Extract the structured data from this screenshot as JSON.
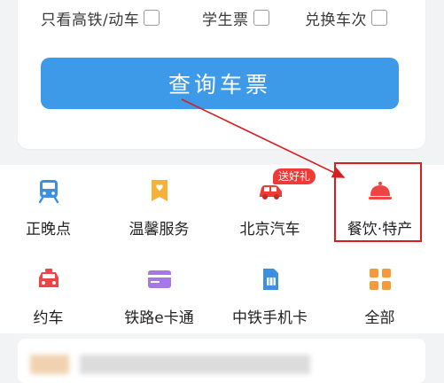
{
  "filters": {
    "gaotie_dongche": "只看高铁/动车",
    "student_ticket": "学生票",
    "exchange_train": "兑换车次"
  },
  "query_button": "查询车票",
  "promo_badge": "送好礼",
  "services_row1": [
    {
      "label": "正晚点",
      "icon": "train-icon"
    },
    {
      "label": "温馨服务",
      "icon": "service-tag-icon"
    },
    {
      "label": "北京汽车",
      "icon": "car-icon"
    },
    {
      "label": "餐饮·特产",
      "icon": "food-cloche-icon"
    }
  ],
  "services_row2": [
    {
      "label": "约车",
      "icon": "taxi-icon"
    },
    {
      "label": "铁路e卡通",
      "icon": "card-icon"
    },
    {
      "label": "中铁手机卡",
      "icon": "sim-card-icon"
    },
    {
      "label": "全部",
      "icon": "grid-icon"
    }
  ],
  "colors": {
    "primary_blue": "#3d9ae8",
    "highlight_red": "#d81e1e",
    "icon_blue": "#3d8fe0",
    "icon_orange": "#f5b13a",
    "icon_red": "#ef4444",
    "icon_purple": "#a678e6",
    "icon_grid_orange": "#f59a3a"
  }
}
